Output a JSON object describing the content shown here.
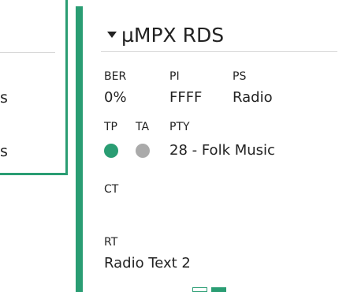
{
  "colors": {
    "accent": "#2a9d73",
    "indicator_off": "#aaaaaa",
    "text": "#222222",
    "divider": "#d8d8d8"
  },
  "left_panel": {
    "fragment_1": "s",
    "fragment_2": "s"
  },
  "rds_panel": {
    "title": "µMPX RDS",
    "collapse_icon": "caret-down-icon",
    "fields": {
      "ber": {
        "label": "BER",
        "value": "0%"
      },
      "pi": {
        "label": "PI",
        "value": "FFFF"
      },
      "ps": {
        "label": "PS",
        "value": "Radio"
      },
      "tp": {
        "label": "TP",
        "state": "on"
      },
      "ta": {
        "label": "TA",
        "state": "off"
      },
      "pty": {
        "label": "PTY",
        "value": "28 - Folk Music"
      },
      "ct": {
        "label": "CT",
        "value": ""
      },
      "rt": {
        "label": "RT",
        "value": "Radio Text 2"
      }
    },
    "pagination": {
      "pages": 2,
      "current": 2
    }
  }
}
